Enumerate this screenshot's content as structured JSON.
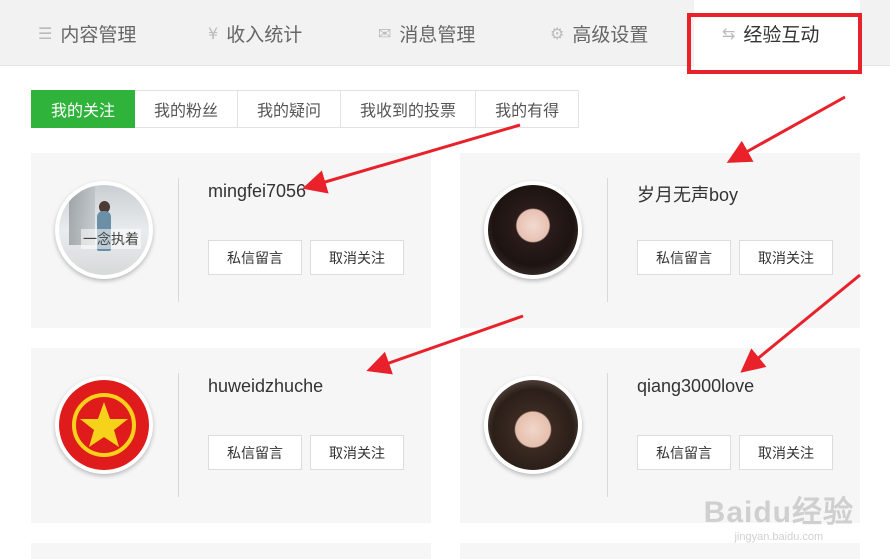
{
  "top_nav": {
    "items": [
      {
        "label": "内容管理",
        "icon": "list-icon"
      },
      {
        "label": "收入统计",
        "icon": "yen-icon"
      },
      {
        "label": "消息管理",
        "icon": "mail-icon"
      },
      {
        "label": "高级设置",
        "icon": "gear-icon"
      },
      {
        "label": "经验互动",
        "icon": "swap-icon"
      }
    ],
    "active_index": 4
  },
  "sub_tabs": {
    "items": [
      "我的关注",
      "我的粉丝",
      "我的疑问",
      "我收到的投票",
      "我的有得"
    ],
    "active_index": 0
  },
  "cards": [
    {
      "username": "mingfei7056",
      "avatar_caption": "一念执着",
      "message_label": "私信留言",
      "unfollow_label": "取消关注"
    },
    {
      "username": "岁月无声boy",
      "message_label": "私信留言",
      "unfollow_label": "取消关注"
    },
    {
      "username": "huweidzhuche",
      "message_label": "私信留言",
      "unfollow_label": "取消关注"
    },
    {
      "username": "qiang3000love",
      "message_label": "私信留言",
      "unfollow_label": "取消关注"
    }
  ],
  "watermark": {
    "brand": "Baidu经验",
    "url": "jingyan.baidu.com"
  },
  "colors": {
    "accent_green": "#2fb33b",
    "annotation_red": "#e8212a",
    "nav_bg": "#f2f2f2",
    "card_bg": "#f6f6f6"
  }
}
